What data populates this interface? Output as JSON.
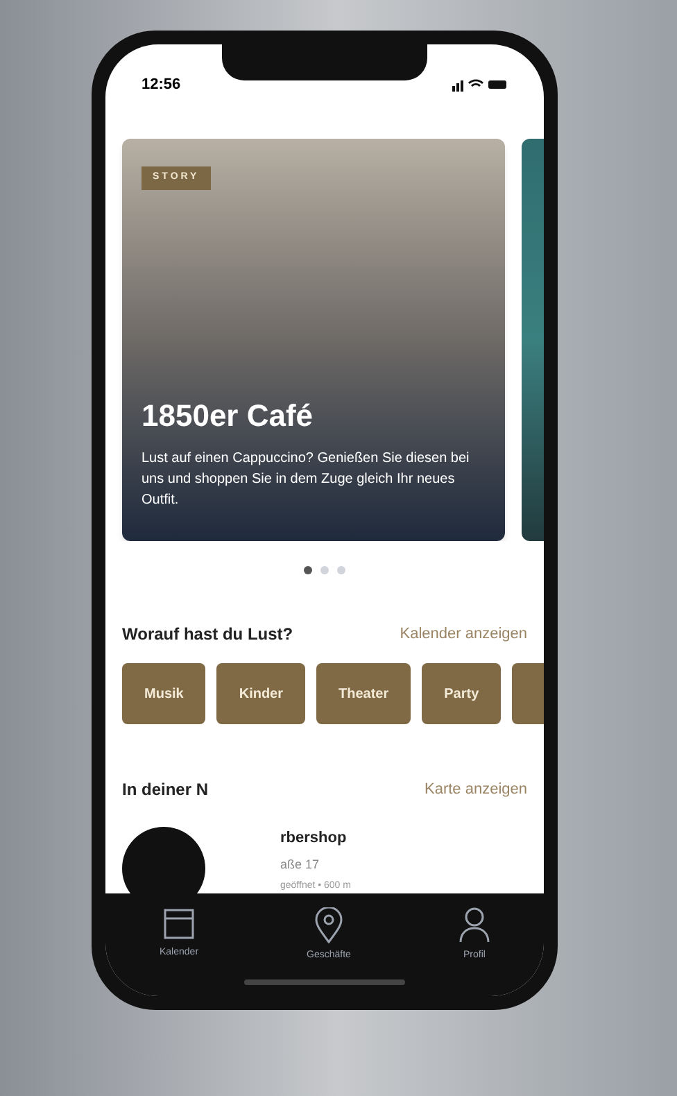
{
  "status_bar": {
    "time": "12:56"
  },
  "story_card": {
    "badge": "STORY",
    "title": "1850er Café",
    "text": "Lust auf einen Cappuccino? Genießen Sie diesen bei uns und shoppen Sie in dem Zuge gleich Ihr neues Outfit."
  },
  "carousel_dots": [
    {
      "selected": true
    },
    {
      "selected": false
    },
    {
      "selected": false
    }
  ],
  "interests": {
    "title": "Worauf hast du Lust?",
    "link": "Kalender anzeigen",
    "chips": [
      {
        "label": "Musik"
      },
      {
        "label": "Kinder"
      },
      {
        "label": "Theater"
      },
      {
        "label": "Party"
      }
    ]
  },
  "nearby": {
    "title": "In deiner N",
    "link": "Karte anzeigen",
    "place": {
      "name": "rbershop",
      "address": "aße 17",
      "meta": "geöffnet • 600 m"
    }
  },
  "tab_bar": [
    {
      "kind": "calendar",
      "label": "Kalender"
    },
    {
      "kind": "pin",
      "label": "Geschäfte"
    },
    {
      "kind": "person",
      "label": "Profil"
    }
  ]
}
